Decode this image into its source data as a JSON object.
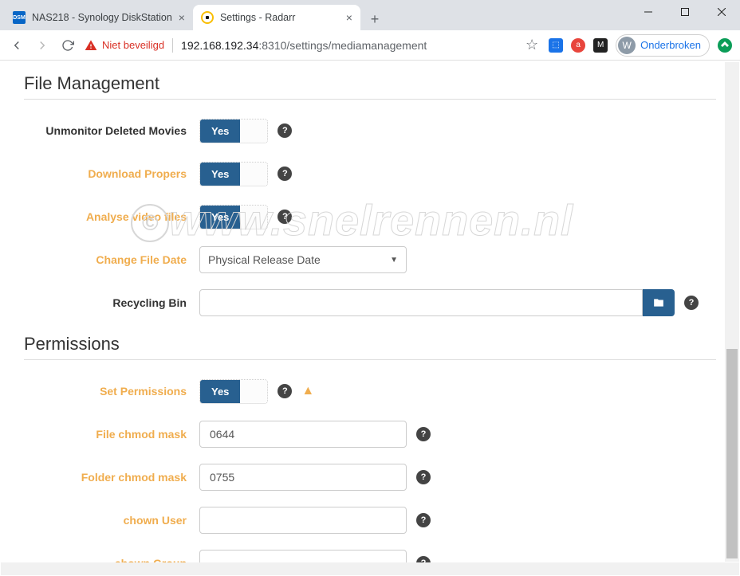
{
  "window": {
    "minimize": "—",
    "maximize": "☐",
    "close": "✕"
  },
  "tabs": {
    "t0": {
      "title": "NAS218 - Synology DiskStation"
    },
    "t1": {
      "title": "Settings - Radarr"
    },
    "newtab": "+"
  },
  "toolbar": {
    "security_text": "Niet beveiligd",
    "url_host": "192.168.192.34",
    "url_port": ":8310",
    "url_path": "/settings/mediamanagement",
    "star": "☆",
    "profile": {
      "initial": "W",
      "label": "Onderbroken"
    }
  },
  "sections": {
    "file_mgmt": {
      "title": "File Management",
      "rows": {
        "unmonitor": {
          "label": "Unmonitor Deleted Movies",
          "val": "Yes"
        },
        "propers": {
          "label": "Download Propers",
          "val": "Yes"
        },
        "analyse": {
          "label": "Analyse video files",
          "val": "Yes"
        },
        "filedate": {
          "label": "Change File Date",
          "selected": "Physical Release Date"
        },
        "recycle": {
          "label": "Recycling Bin"
        }
      }
    },
    "perms": {
      "title": "Permissions",
      "rows": {
        "setperm": {
          "label": "Set Permissions",
          "val": "Yes"
        },
        "filemask": {
          "label": "File chmod mask",
          "val": "0644"
        },
        "foldermask": {
          "label": "Folder chmod mask",
          "val": "0755"
        },
        "chownuser": {
          "label": "chown User",
          "val": ""
        },
        "chowngroup": {
          "label": "chown Group",
          "val": ""
        }
      }
    }
  },
  "watermark": "www.snelrennen.nl",
  "copyright": "©"
}
